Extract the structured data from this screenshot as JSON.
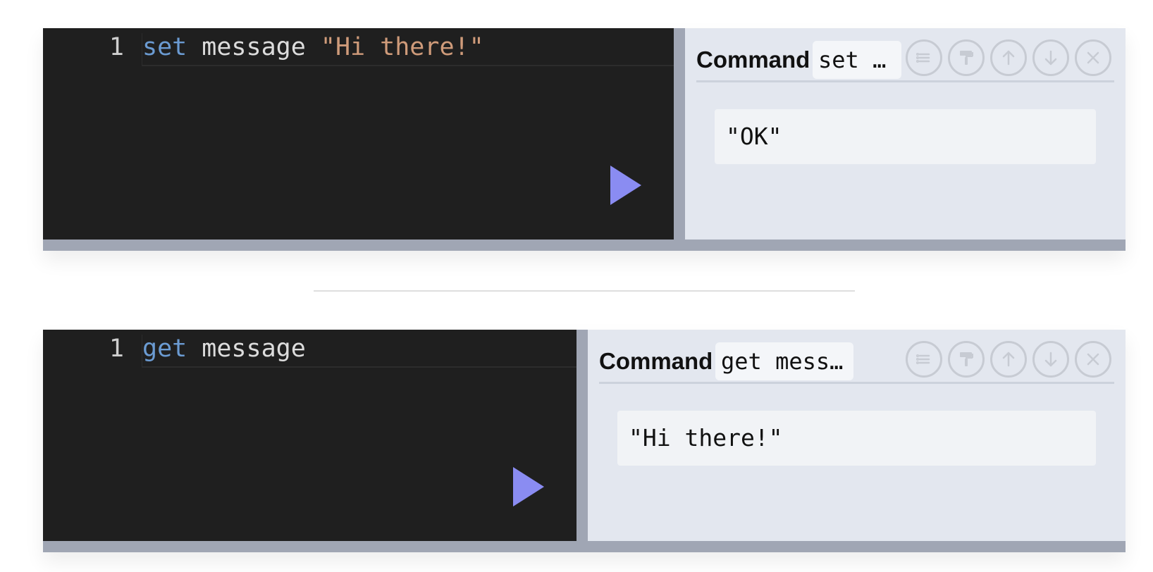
{
  "cells": [
    {
      "line_number": "1",
      "code": {
        "keyword": "set",
        "rest": " message ",
        "string": "\"Hi there!\""
      },
      "command_label": "Command",
      "command_preview": "set …",
      "result": "\"OK\""
    },
    {
      "line_number": "1",
      "code": {
        "keyword": "get",
        "rest": " message",
        "string": ""
      },
      "command_label": "Command",
      "command_preview": "get mess…",
      "result": "\"Hi there!\""
    }
  ],
  "toolbar_icons": [
    "list-icon",
    "paint-roller-icon",
    "arrow-up-icon",
    "arrow-down-icon",
    "close-icon"
  ],
  "colors": {
    "editor_bg": "#1f1f1f",
    "keyword": "#6b9bd2",
    "string": "#cf9b7a",
    "run_button": "#8a8cf2",
    "output_bg": "#e3e7ef",
    "divider": "#a0a6b4"
  }
}
